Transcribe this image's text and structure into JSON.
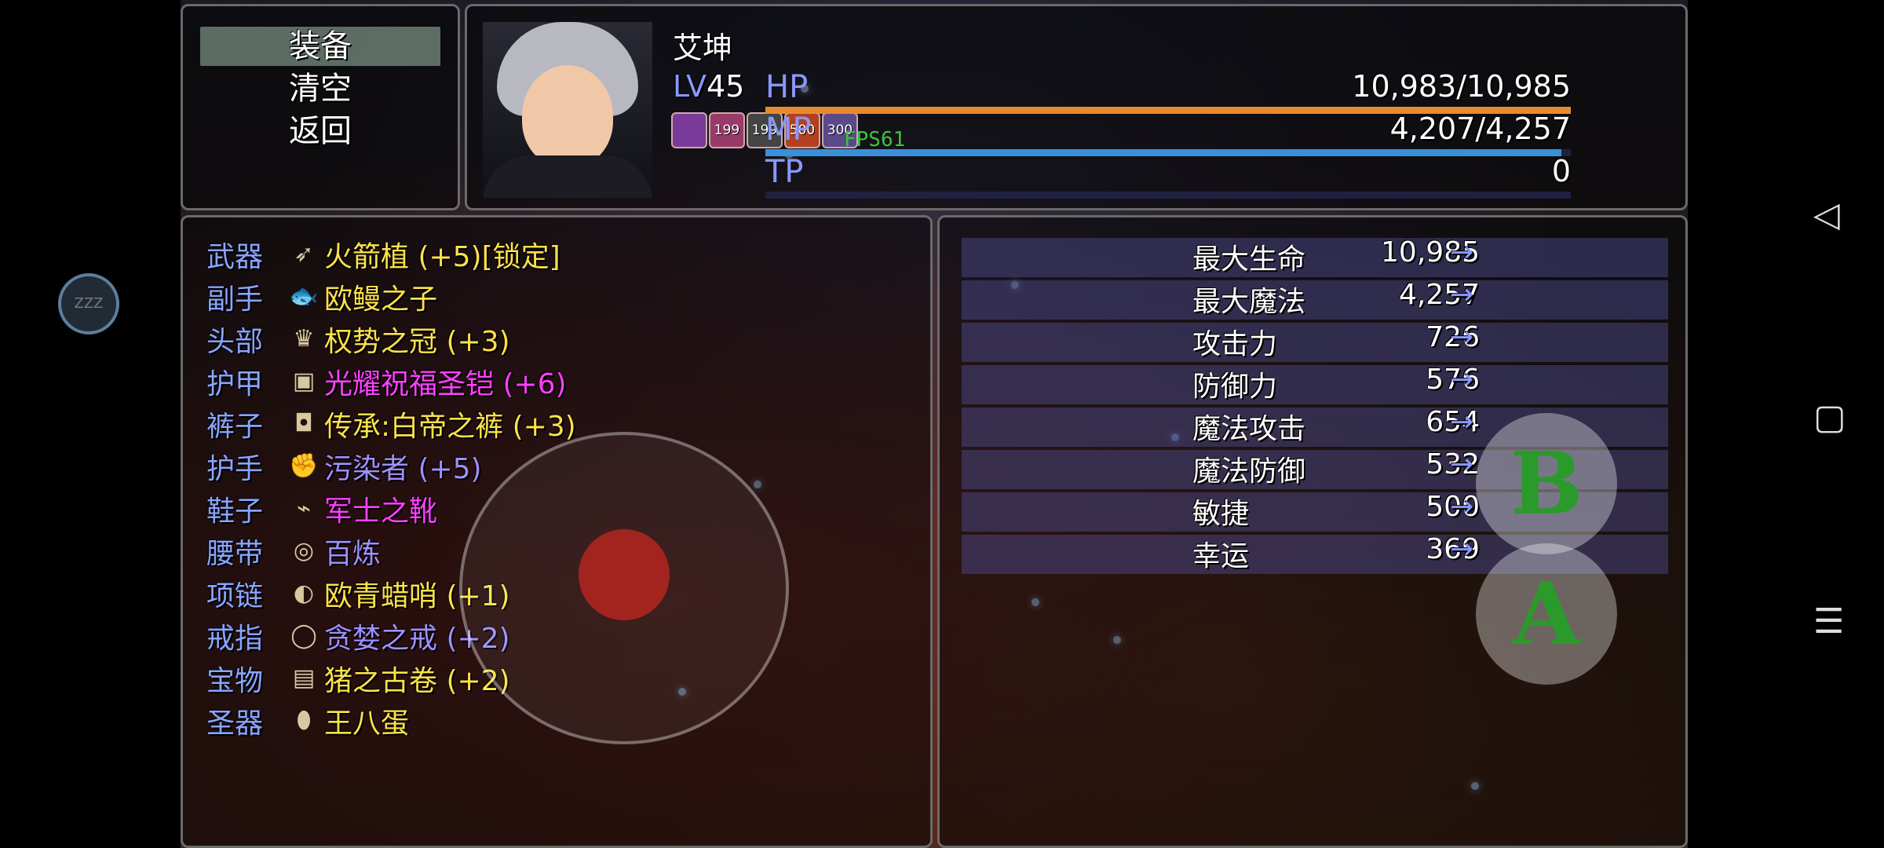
{
  "commands": [
    {
      "label": "装备",
      "selected": true
    },
    {
      "label": "清空",
      "selected": false
    },
    {
      "label": "返回",
      "selected": false
    }
  ],
  "actor": {
    "name": "艾坤",
    "level_label": "LV",
    "level": "45",
    "states": [
      {
        "text": "",
        "icon": "fang-icon",
        "color": "#7a3a9a"
      },
      {
        "text": "199",
        "icon": "gift-icon",
        "color": "#9a3a6a"
      },
      {
        "text": "199",
        "icon": "skull-icon",
        "color": "#444"
      },
      {
        "text": "500",
        "icon": "sword-icon",
        "color": "#b34020"
      },
      {
        "text": "300",
        "icon": "shield-icon",
        "color": "#5a4a8a"
      }
    ],
    "hp": {
      "label": "HP",
      "value": "10,983/10,985",
      "ratio": 0.9998,
      "color": "#e88a30"
    },
    "mp": {
      "label": "MP",
      "value": "4,207/4,257",
      "ratio": 0.988,
      "color": "#3a90d8"
    },
    "tp": {
      "label": "TP",
      "value": "0",
      "ratio": 0,
      "color": "#3aa060"
    }
  },
  "fps_label": "FPS61",
  "equipment": [
    {
      "slot": "武器",
      "item": "火箭植 (+5)[锁定]",
      "color": "#ffe14a",
      "icon": "rocket-icon",
      "glyph": "➶"
    },
    {
      "slot": "副手",
      "item": "欧鳗之子",
      "color": "#ffe14a",
      "icon": "fish-icon",
      "glyph": "🐟"
    },
    {
      "slot": "头部",
      "item": "权势之冠 (+3)",
      "color": "#ffe14a",
      "icon": "crown-icon",
      "glyph": "♛"
    },
    {
      "slot": "护甲",
      "item": "光耀祝福圣铠 (+6)",
      "color": "#ff40ff",
      "icon": "armor-icon",
      "glyph": "▣"
    },
    {
      "slot": "裤子",
      "item": "传承:白帝之裤 (+3)",
      "color": "#ffe14a",
      "icon": "pants-icon",
      "glyph": "◘"
    },
    {
      "slot": "护手",
      "item": "污染者 (+5)",
      "color": "#a090ff",
      "icon": "gauntlet-icon",
      "glyph": "✊"
    },
    {
      "slot": "鞋子",
      "item": "军士之靴",
      "color": "#ff40ff",
      "icon": "boot-icon",
      "glyph": "⌁"
    },
    {
      "slot": "腰带",
      "item": "百炼",
      "color": "#a090ff",
      "icon": "belt-icon",
      "glyph": "◎"
    },
    {
      "slot": "项链",
      "item": "欧青蜡哨 (+1)",
      "color": "#ffe14a",
      "icon": "whistle-icon",
      "glyph": "◐"
    },
    {
      "slot": "戒指",
      "item": "贪婪之戒 (+2)",
      "color": "#a090ff",
      "icon": "ring-icon",
      "glyph": "◯"
    },
    {
      "slot": "宝物",
      "item": "猪之古卷 (+2)",
      "color": "#ffe14a",
      "icon": "scroll-icon",
      "glyph": "▤"
    },
    {
      "slot": "圣器",
      "item": "王八蛋",
      "color": "#ffe14a",
      "icon": "egg-icon",
      "glyph": "⬮"
    }
  ],
  "params": [
    {
      "name": "最大生命",
      "value": "10,985",
      "arrow": "→"
    },
    {
      "name": "最大魔法",
      "value": "4,257",
      "arrow": "→"
    },
    {
      "name": "攻击力",
      "value": "726",
      "arrow": "→"
    },
    {
      "name": "防御力",
      "value": "576",
      "arrow": "→"
    },
    {
      "name": "魔法攻击",
      "value": "654",
      "arrow": "→"
    },
    {
      "name": "魔法防御",
      "value": "532",
      "arrow": "→"
    },
    {
      "name": "敏捷",
      "value": "500",
      "arrow": "→"
    },
    {
      "name": "幸运",
      "value": "369",
      "arrow": "→"
    }
  ],
  "touch": {
    "a_label": "A",
    "b_label": "B"
  },
  "overlay": {
    "zzz": "ZZZ"
  },
  "system_nav": {
    "back": "◁",
    "home": "▢",
    "menu": "☰"
  }
}
